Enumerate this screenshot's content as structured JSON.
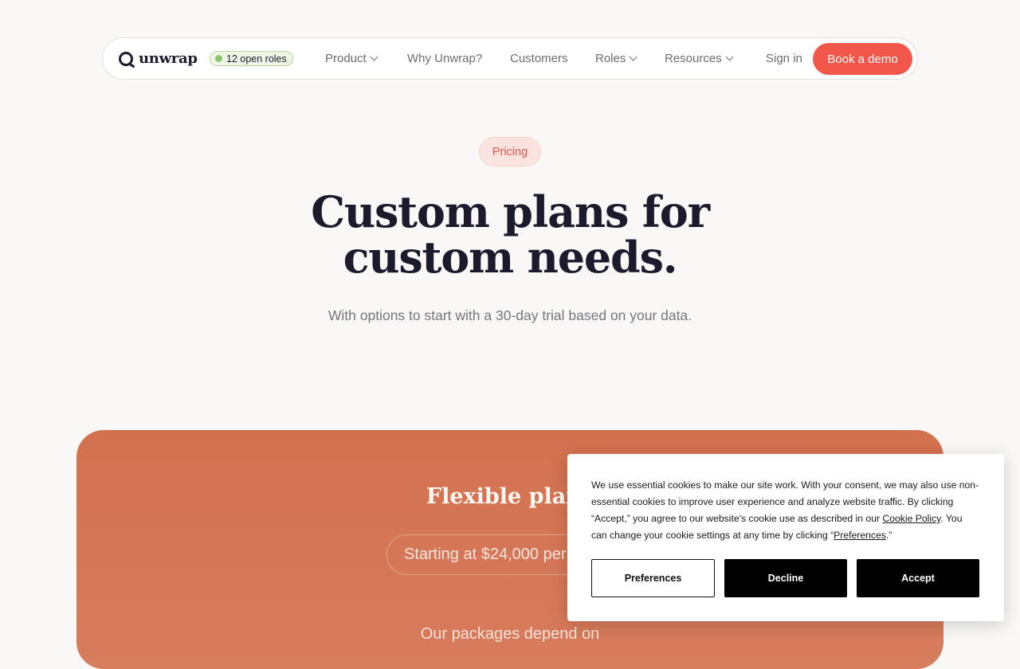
{
  "nav": {
    "logo_text": "unwrap",
    "roles_badge": "12 open roles",
    "items": [
      {
        "label": "Product",
        "dropdown": true
      },
      {
        "label": "Why Unwrap?",
        "dropdown": false
      },
      {
        "label": "Customers",
        "dropdown": false
      },
      {
        "label": "Roles",
        "dropdown": true
      },
      {
        "label": "Resources",
        "dropdown": true
      }
    ],
    "sign_in": "Sign in",
    "book_demo": "Book a demo"
  },
  "hero": {
    "pill": "Pricing",
    "title_line1": "Custom plans for",
    "title_line2": "custom needs.",
    "subtitle": "With options to start with a 30-day trial based on your data."
  },
  "pricing_card": {
    "title": "Flexible plans",
    "price": "Starting at $24,000 per year",
    "description": "Our packages depend on"
  },
  "cookie_banner": {
    "text_part1": "We use essential cookies to make our site work. With your consent, we may also use non-essential cookies to improve user experience and analyze website traffic. By clicking “Accept,” you agree to our website's cookie use as described in our ",
    "cookie_policy_link": "Cookie Policy",
    "text_part2": ". You can change your cookie settings at any time by clicking “",
    "preferences_link": "Preferences",
    "text_part3": ".”",
    "buttons": {
      "preferences": "Preferences",
      "decline": "Decline",
      "accept": "Accept"
    }
  },
  "colors": {
    "accent": "#f3574a",
    "card": "#d3714f",
    "roles_green": "#8ec46b"
  }
}
